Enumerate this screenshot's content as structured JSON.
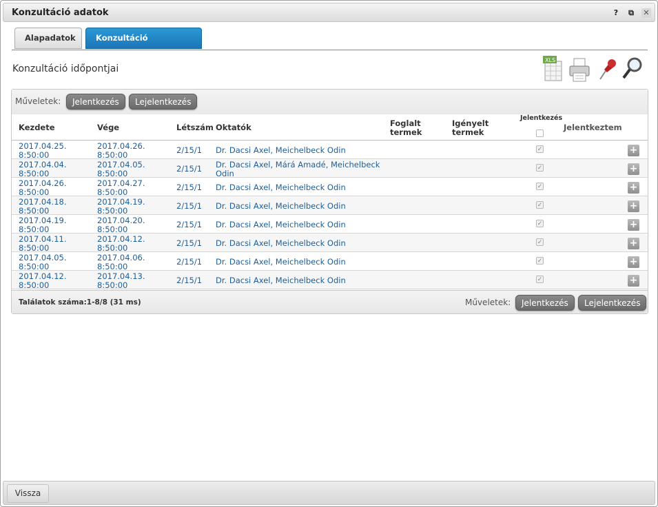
{
  "window": {
    "title": "Konzultáció adatok",
    "help": "?",
    "popout": "⧉",
    "close": "✕"
  },
  "tabs": [
    {
      "label": "Alapadatok"
    },
    {
      "label": "Konzultáció időpontjai"
    }
  ],
  "section": {
    "title": "Konzultáció időpontjai"
  },
  "toolbar": {
    "icons": [
      "excel-export-icon",
      "print-icon",
      "pin-icon",
      "search-icon"
    ]
  },
  "grid": {
    "ops_label": "Műveletek:",
    "register_label": "Jelentkezés",
    "unregister_label": "Lejelentkezés",
    "headers": {
      "start": "Kezdete",
      "end": "Vége",
      "headcount": "Létszám",
      "instructors": "Oktatók",
      "booked_rooms_1": "Foglalt",
      "booked_rooms_2": "termek",
      "requested_rooms_1": "Igényelt",
      "requested_rooms_2": "termek",
      "registration": "Jelentkezés",
      "registered": "Jelentkeztem"
    },
    "rows": [
      {
        "start_date": "2017.04.25.",
        "start_time": "8:50:00",
        "end_date": "2017.04.26.",
        "end_time": "8:50:00",
        "headcount": "2/15/1",
        "instructors_1": "Dr. Dacsi Axel, Meichelbeck Odin",
        "instructors_2": ""
      },
      {
        "start_date": "2017.04.04.",
        "start_time": "8:50:00",
        "end_date": "2017.04.05.",
        "end_time": "8:50:00",
        "headcount": "2/15/1",
        "instructors_1": "Dr. Dacsi Axel, Márá Amadé, Meichelbeck",
        "instructors_2": "Odin"
      },
      {
        "start_date": "2017.04.26.",
        "start_time": "8:50:00",
        "end_date": "2017.04.27.",
        "end_time": "8:50:00",
        "headcount": "2/15/1",
        "instructors_1": "Dr. Dacsi Axel, Meichelbeck Odin",
        "instructors_2": ""
      },
      {
        "start_date": "2017.04.18.",
        "start_time": "8:50:00",
        "end_date": "2017.04.19.",
        "end_time": "8:50:00",
        "headcount": "2/15/1",
        "instructors_1": "Dr. Dacsi Axel, Meichelbeck Odin",
        "instructors_2": ""
      },
      {
        "start_date": "2017.04.19.",
        "start_time": "8:50:00",
        "end_date": "2017.04.20.",
        "end_time": "8:50:00",
        "headcount": "2/15/1",
        "instructors_1": "Dr. Dacsi Axel, Meichelbeck Odin",
        "instructors_2": ""
      },
      {
        "start_date": "2017.04.11.",
        "start_time": "8:50:00",
        "end_date": "2017.04.12.",
        "end_time": "8:50:00",
        "headcount": "2/15/1",
        "instructors_1": "Dr. Dacsi Axel, Meichelbeck Odin",
        "instructors_2": ""
      },
      {
        "start_date": "2017.04.05.",
        "start_time": "8:50:00",
        "end_date": "2017.04.06.",
        "end_time": "8:50:00",
        "headcount": "2/15/1",
        "instructors_1": "Dr. Dacsi Axel, Meichelbeck Odin",
        "instructors_2": ""
      },
      {
        "start_date": "2017.04.12.",
        "start_time": "8:50:00",
        "end_date": "2017.04.13.",
        "end_time": "8:50:00",
        "headcount": "2/15/1",
        "instructors_1": "Dr. Dacsi Axel, Meichelbeck Odin",
        "instructors_2": ""
      }
    ],
    "results": "Találatok száma:1-8/8 (31 ms)"
  },
  "footer": {
    "back_label": "Vissza"
  }
}
